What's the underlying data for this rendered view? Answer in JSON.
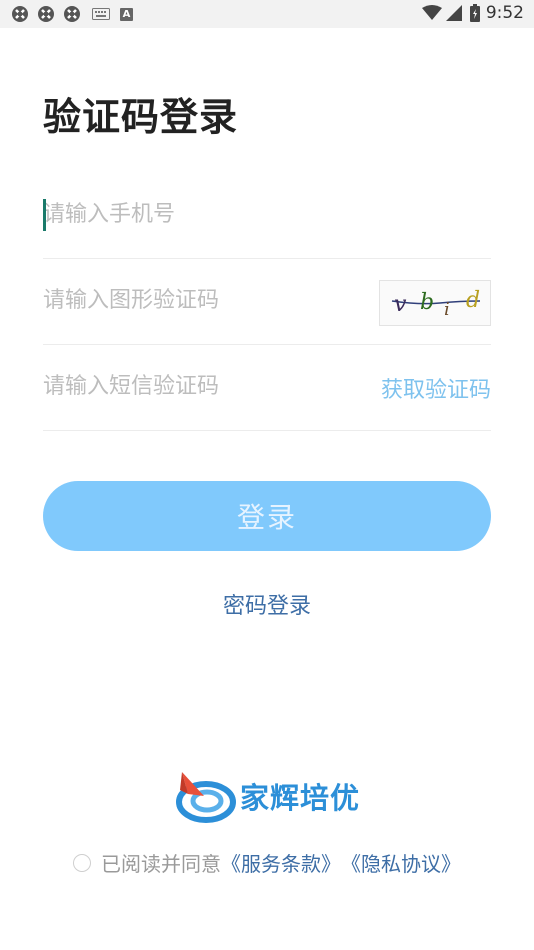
{
  "status_bar": {
    "time": "9:52",
    "keyboard_letter": "A"
  },
  "page": {
    "title": "验证码登录"
  },
  "form": {
    "phone_placeholder": "请输入手机号",
    "captcha_placeholder": "请输入图形验证码",
    "captcha_text": "vbid",
    "sms_placeholder": "请输入短信验证码",
    "get_code_label": "获取验证码",
    "login_label": "登录",
    "password_login_label": "密码登录"
  },
  "brand": {
    "name": "家辉培优"
  },
  "agreement": {
    "prefix": "已阅读并同意",
    "terms": "《服务条款》",
    "privacy": "《隐私协议》"
  },
  "colors": {
    "accent": "#80c9fc",
    "link": "#3e6ea6",
    "get_code": "#7ec2ee"
  }
}
